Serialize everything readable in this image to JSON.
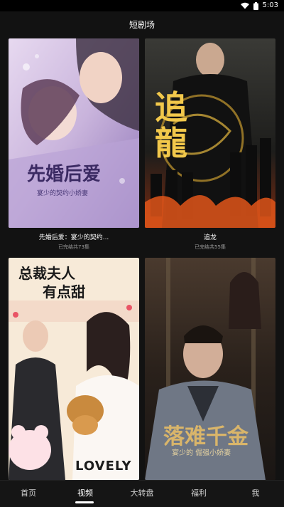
{
  "status": {
    "time": "5:03"
  },
  "header": {
    "title": "短剧场"
  },
  "cards": [
    {
      "poster_title": "先婚后爱",
      "poster_subtitle": "宴少的契约小娇妻",
      "title": "先婚后爱：宴少的契约...",
      "subtitle": "已完结共73集"
    },
    {
      "poster_title": "追龍",
      "title": "追龙",
      "subtitle": "已完结共55集"
    },
    {
      "poster_title_line1": "总裁夫人",
      "poster_title_line2": "有点甜",
      "poster_caption": "LOVELY"
    },
    {
      "poster_title": "落难千金",
      "poster_subtitle": "宴少的 倔强小娇妻"
    }
  ],
  "tabs": [
    {
      "label": "首页"
    },
    {
      "label": "视频"
    },
    {
      "label": "大转盘"
    },
    {
      "label": "福利"
    },
    {
      "label": "我"
    }
  ],
  "active_tab": "视频",
  "colors": {
    "background": "#121212",
    "accent": "#ffffff",
    "subtitle": "#9a9a9a"
  }
}
